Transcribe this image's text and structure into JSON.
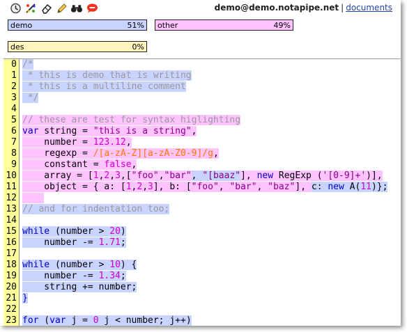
{
  "toolbar": {
    "icons": [
      "clock-icon",
      "palette-icon",
      "eraser-icon",
      "pencil-icon",
      "binoculars-icon",
      "chat-icon"
    ]
  },
  "user": {
    "email": "demo@demo.notapipe.net",
    "separator": "|",
    "documents_link": "documents"
  },
  "authors": [
    {
      "name": "demo",
      "percent": "51%",
      "color": "#c8d4ff"
    },
    {
      "name": "other",
      "percent": "49%",
      "color": "#ffc3ff"
    },
    {
      "name": "des",
      "percent": "0%",
      "color": "#fff4bb"
    }
  ],
  "editor": {
    "line_numbers": [
      "0",
      "1",
      "2",
      "3",
      "4",
      "5",
      "6",
      "7",
      "8",
      "9",
      "10",
      "11",
      "12",
      "13",
      "14",
      "15",
      "16",
      "17",
      "18",
      "19",
      "20",
      "21",
      "22",
      "23"
    ],
    "lines": [
      [
        {
          "t": "/*",
          "c": "c",
          "h": "b"
        }
      ],
      [
        {
          "t": " * this is demo that is writing",
          "c": "c",
          "h": "b"
        }
      ],
      [
        {
          "t": " * this is a multiline comment",
          "c": "c",
          "h": "b"
        }
      ],
      [
        {
          "t": " */",
          "c": "c",
          "h": "b"
        }
      ],
      [],
      [
        {
          "t": "// these are test for syntax higlighting",
          "c": "c",
          "h": "p"
        }
      ],
      [
        {
          "t": "var",
          "c": "k",
          "h": "p"
        },
        {
          "t": " string = ",
          "c": "v",
          "h": "p"
        },
        {
          "t": "\"this is a string\"",
          "c": "s",
          "h": "p"
        },
        {
          "t": ",",
          "c": "p",
          "h": "p"
        }
      ],
      [
        {
          "t": "    number = ",
          "c": "v",
          "h": "p"
        },
        {
          "t": "123.12",
          "c": "n",
          "h": "p"
        },
        {
          "t": ",",
          "c": "p",
          "h": "p"
        }
      ],
      [
        {
          "t": "    regexp = ",
          "c": "v",
          "h": "p"
        },
        {
          "t": "/[a-zA-Z][a-zA-Z0-9]/g",
          "c": "r",
          "h": "p"
        },
        {
          "t": ",",
          "c": "p",
          "h": "p"
        }
      ],
      [
        {
          "t": "    constant = ",
          "c": "v",
          "h": "p"
        },
        {
          "t": "false",
          "c": "n",
          "h": "p"
        },
        {
          "t": ",",
          "c": "p",
          "h": "p"
        }
      ],
      [
        {
          "t": "    array = [",
          "c": "v",
          "h": "p"
        },
        {
          "t": "1",
          "c": "n",
          "h": "p"
        },
        {
          "t": ",",
          "c": "p",
          "h": "p"
        },
        {
          "t": "2",
          "c": "n",
          "h": "p"
        },
        {
          "t": ",",
          "c": "p",
          "h": "p"
        },
        {
          "t": "3",
          "c": "n",
          "h": "p"
        },
        {
          "t": ",[",
          "c": "p",
          "h": "p"
        },
        {
          "t": "\"foo\"",
          "c": "s",
          "h": "p"
        },
        {
          "t": ",",
          "c": "p",
          "h": "p"
        },
        {
          "t": "\"bar\"",
          "c": "s",
          "h": "p"
        },
        {
          "t": ", ",
          "c": "p",
          "h": "b"
        },
        {
          "t": "\"[baaz\"",
          "c": "s",
          "h": "b"
        },
        {
          "t": "], ",
          "c": "p",
          "h": "p"
        },
        {
          "t": "new",
          "c": "k",
          "h": "p"
        },
        {
          "t": " RegExp (",
          "c": "v",
          "h": "p"
        },
        {
          "t": "'[0-9]+'",
          "c": "s",
          "h": "p"
        },
        {
          "t": ")],",
          "c": "p",
          "h": "p"
        }
      ],
      [
        {
          "t": "    object = { a: [",
          "c": "v",
          "h": "p"
        },
        {
          "t": "1",
          "c": "n",
          "h": "p"
        },
        {
          "t": ",",
          "c": "p",
          "h": "p"
        },
        {
          "t": "2",
          "c": "n",
          "h": "p"
        },
        {
          "t": ",",
          "c": "p",
          "h": "p"
        },
        {
          "t": "3",
          "c": "n",
          "h": "p"
        },
        {
          "t": "], b: [",
          "c": "p",
          "h": "p"
        },
        {
          "t": "\"foo\"",
          "c": "s",
          "h": "p"
        },
        {
          "t": ", ",
          "c": "p",
          "h": "p"
        },
        {
          "t": "\"bar\"",
          "c": "s",
          "h": "p"
        },
        {
          "t": ", ",
          "c": "p",
          "h": "p"
        },
        {
          "t": "\"baz\"",
          "c": "s",
          "h": "p"
        },
        {
          "t": "], ",
          "c": "p",
          "h": "p"
        },
        {
          "t": "c: ",
          "c": "v",
          "h": "b"
        },
        {
          "t": "new",
          "c": "k",
          "h": "b"
        },
        {
          "t": " A(",
          "c": "v",
          "h": "b"
        },
        {
          "t": "11",
          "c": "n",
          "h": "b"
        },
        {
          "t": ")};",
          "c": "p",
          "h": "b"
        }
      ],
      [
        {
          "t": "    ",
          "c": "v",
          "h": "p"
        }
      ],
      [
        {
          "t": "// and for indentation too;",
          "c": "c",
          "h": "b"
        }
      ],
      [],
      [
        {
          "t": "while",
          "c": "k",
          "h": "b"
        },
        {
          "t": " (number ",
          "c": "v",
          "h": "b"
        },
        {
          "t": ">",
          "c": "p",
          "h": "b"
        },
        {
          "t": " ",
          "c": "v",
          "h": "b"
        },
        {
          "t": "20",
          "c": "n",
          "h": "b"
        },
        {
          "t": ")",
          "c": "p",
          "h": "b"
        }
      ],
      [
        {
          "t": "    number -= ",
          "c": "v",
          "h": "b"
        },
        {
          "t": "1.71",
          "c": "n",
          "h": "b"
        },
        {
          "t": ";",
          "c": "p",
          "h": "b"
        }
      ],
      [],
      [
        {
          "t": "while",
          "c": "k",
          "h": "b"
        },
        {
          "t": " (number ",
          "c": "v",
          "h": "b"
        },
        {
          "t": ">",
          "c": "p",
          "h": "b"
        },
        {
          "t": " ",
          "c": "v",
          "h": "b"
        },
        {
          "t": "10",
          "c": "n",
          "h": "b"
        },
        {
          "t": ") {",
          "c": "p",
          "h": "b"
        }
      ],
      [
        {
          "t": "    number -= ",
          "c": "v",
          "h": "b"
        },
        {
          "t": "1.34",
          "c": "n",
          "h": "b"
        },
        {
          "t": ";",
          "c": "p",
          "h": "b"
        }
      ],
      [
        {
          "t": "    string += number;",
          "c": "v",
          "h": "b"
        }
      ],
      [
        {
          "t": "}",
          "c": "k",
          "h": "b"
        }
      ],
      [],
      [
        {
          "t": "for",
          "c": "k",
          "h": "b"
        },
        {
          "t": " (",
          "c": "p",
          "h": "b"
        },
        {
          "t": "var",
          "c": "k",
          "h": "b"
        },
        {
          "t": " j = ",
          "c": "v",
          "h": "b"
        },
        {
          "t": "0",
          "c": "n",
          "h": "b"
        },
        {
          "t": " j < number; j++)",
          "c": "v",
          "h": "b"
        }
      ]
    ]
  }
}
